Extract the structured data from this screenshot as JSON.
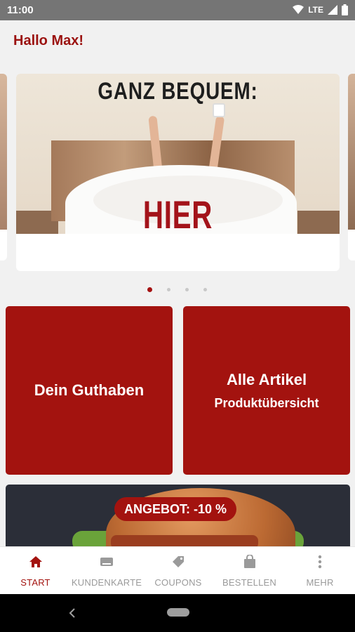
{
  "status_bar": {
    "time": "11:00",
    "network": "LTE"
  },
  "header": {
    "greeting": "Hallo Max!"
  },
  "carousel": {
    "banner_line1": "GANZ BEQUEM:",
    "banner_line2": "HIER BESTELLEN!",
    "pages": 4,
    "active_page": 1
  },
  "tiles": [
    {
      "title": "Dein Guthaben"
    },
    {
      "title": "Alle Artikel",
      "subtitle": "Produktübersicht"
    }
  ],
  "promo": {
    "badge": "ANGEBOT: -10 %"
  },
  "bottom_nav": {
    "items": [
      {
        "label": "START",
        "icon": "home-icon",
        "active": true
      },
      {
        "label": "KUNDENKARTE",
        "icon": "card-icon",
        "active": false
      },
      {
        "label": "COUPONS",
        "icon": "tag-icon",
        "active": false
      },
      {
        "label": "BESTELLEN",
        "icon": "shopping-bag-icon",
        "active": false
      },
      {
        "label": "MEHR",
        "icon": "more-vertical-icon",
        "active": false
      }
    ]
  },
  "colors": {
    "brand": "#a3130f",
    "status_bar": "#757575"
  }
}
